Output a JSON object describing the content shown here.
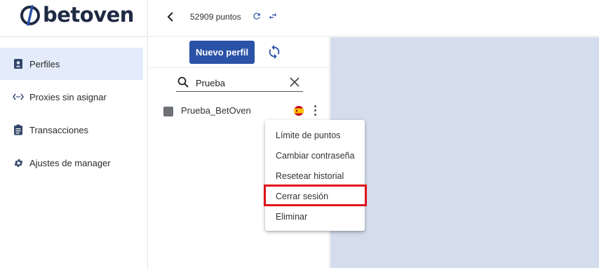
{
  "brand": {
    "name": "betoven",
    "color": "#1f2a44"
  },
  "sidebar": {
    "items": [
      {
        "label": "Perfiles",
        "icon": "contacts-icon",
        "active": true
      },
      {
        "label": "Proxies sin asignar",
        "icon": "code-arrows-icon",
        "active": false
      },
      {
        "label": "Transacciones",
        "icon": "clipboard-icon",
        "active": false
      },
      {
        "label": "Ajustes de manager",
        "icon": "gear-icon",
        "active": false
      }
    ]
  },
  "topbar": {
    "points": "52909 puntos",
    "back_icon": "chevron-left-icon",
    "refresh_icon": "refresh-icon",
    "swap_icon": "swap-arrows-icon"
  },
  "panel": {
    "new_profile_label": "Nuevo perfil",
    "search": {
      "value": "Prueba",
      "placeholder": ""
    },
    "profiles": [
      {
        "name": "Prueba_BetOven",
        "flag": "spain-flag-icon"
      }
    ]
  },
  "context_menu": {
    "items": [
      {
        "label": "Límite de puntos"
      },
      {
        "label": "Cambiar contraseña"
      },
      {
        "label": "Resetear historial"
      },
      {
        "label": "Cerrar sesión",
        "highlighted": true
      },
      {
        "label": "Eliminar"
      }
    ]
  },
  "colors": {
    "accent": "#2a52a6",
    "active_nav": "#e4ecfb",
    "workspace": "#d3ddeb",
    "highlight": "#e0121a"
  }
}
